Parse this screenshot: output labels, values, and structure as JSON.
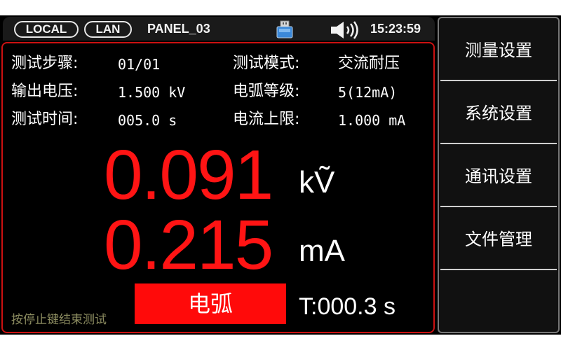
{
  "status_bar": {
    "local": "LOCAL",
    "lan": "LAN",
    "panel": "PANEL_03",
    "usb_icon": "usb-drive-icon",
    "speaker_icon": "speaker-on-icon",
    "time": "15:23:59"
  },
  "params": {
    "step_label": "测试步骤:",
    "step_value": "01/01",
    "mode_label": "测试模式:",
    "mode_value": "交流耐压",
    "voltage_label": "输出电压:",
    "voltage_value": "1.500 kV",
    "arc_label": "电弧等级:",
    "arc_value": "5(12mA)",
    "time_label": "测试时间:",
    "time_value": "005.0 s",
    "limit_label": "电流上限:",
    "limit_value": "1.000 mA"
  },
  "measurement": {
    "voltage": "0.091",
    "voltage_unit": "kṼ",
    "current": "0.215",
    "current_unit": "mA"
  },
  "footer": {
    "hint": "按停止键结束测试",
    "arc_status": "电弧",
    "timer": "T:000.3 s"
  },
  "menu": {
    "items": [
      "测量设置",
      "系统设置",
      "通讯设置",
      "文件管理"
    ]
  },
  "colors": {
    "reading_red": "#ff1414",
    "panel_border": "#cc1111",
    "arc_badge": "#ff0a0a"
  }
}
